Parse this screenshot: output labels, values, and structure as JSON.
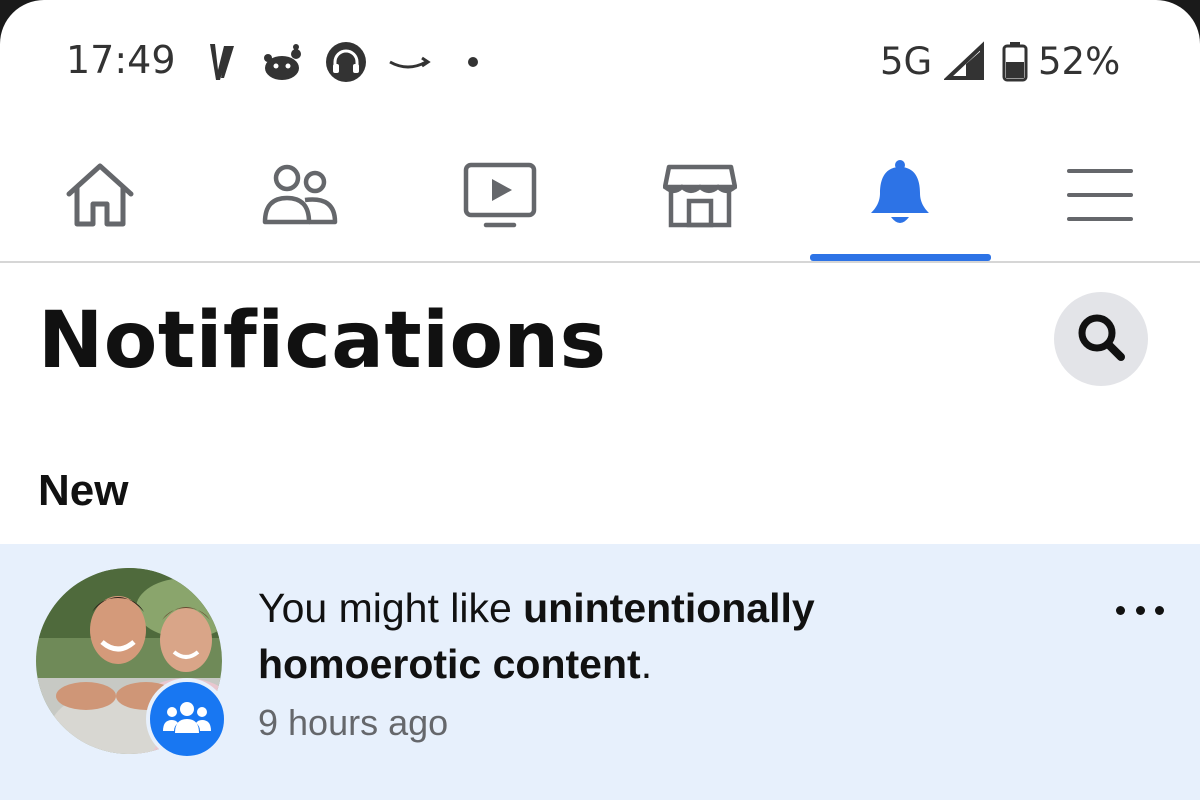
{
  "status_bar": {
    "time": "17:49",
    "network": "5G",
    "battery": "52%",
    "notification_icons": [
      "v-app-icon",
      "reddit-icon",
      "headphones-icon",
      "amazon-icon",
      "dot-icon"
    ]
  },
  "nav_tabs": [
    {
      "name": "home",
      "icon": "home-icon",
      "active": false
    },
    {
      "name": "friends",
      "icon": "friends-icon",
      "active": false
    },
    {
      "name": "watch",
      "icon": "video-icon",
      "active": false
    },
    {
      "name": "marketplace",
      "icon": "marketplace-icon",
      "active": false
    },
    {
      "name": "notifications",
      "icon": "bell-icon",
      "active": true
    },
    {
      "name": "menu",
      "icon": "menu-icon",
      "active": false
    }
  ],
  "header": {
    "title": "Notifications",
    "search_icon": "search-icon"
  },
  "section": {
    "label": "New"
  },
  "notification": {
    "text_prefix": "You might like ",
    "text_bold": "unintentionally homoerotic content",
    "text_suffix": ".",
    "time": "9 hours ago",
    "badge_icon": "group-icon",
    "more_icon": "more-options-icon"
  },
  "colors": {
    "accent": "#2d73e6",
    "highlight_bg": "#e7f0fc",
    "badge": "#1877f2"
  }
}
